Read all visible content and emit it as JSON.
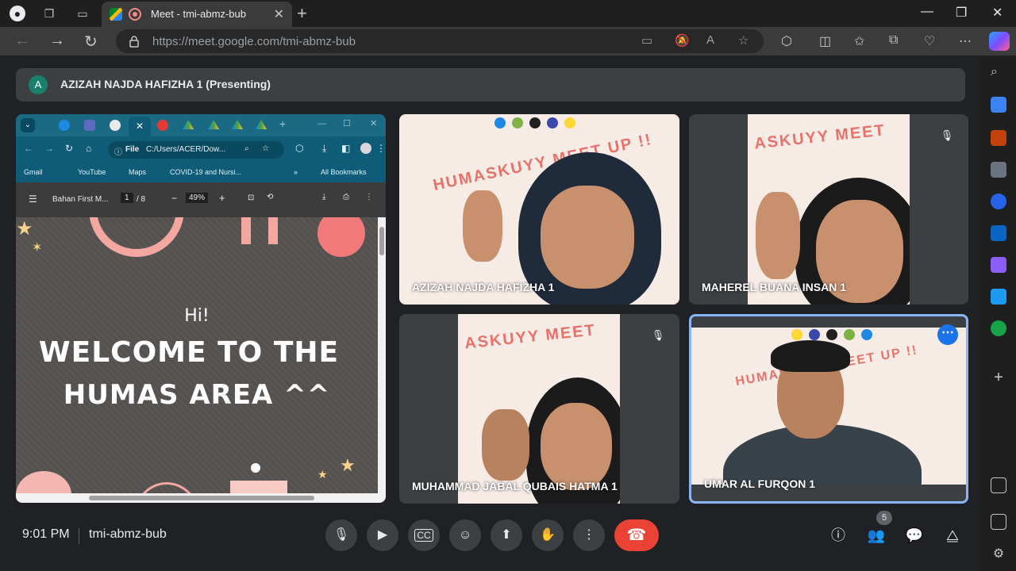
{
  "browser": {
    "tab_title": "Meet - tmi-abmz-bub",
    "url_domain": "https://meet.google.com/",
    "url_path": "tmi-abmz-bub"
  },
  "presenting_banner": {
    "avatar_letter": "A",
    "text": "AZIZAH NAJDA HAFIZHA 1 (Presenting)"
  },
  "shared_screen": {
    "file_label": "File",
    "path": "C:/Users/ACER/Dow...",
    "bookmarks": [
      "Gmail",
      "YouTube",
      "Maps",
      "COVID-19 and Nursi..."
    ],
    "all_bookmarks": "All Bookmarks",
    "pdf_title": "Bahan First M...",
    "page_current": "1",
    "page_total": "/ 8",
    "zoom": "49%",
    "slide_hi": "Hi!",
    "slide_line1": "WELCOME TO THE",
    "slide_line2": "HUMAS AREA ^^"
  },
  "participants": [
    {
      "name": "AZIZAH NAJDA HAFIZHA 1",
      "muted": false,
      "banner": "HUMASKUYY MEET UP !!"
    },
    {
      "name": "MAHEREL BUANA INSAN 1",
      "muted": true,
      "banner": "ASKUYY MEET"
    },
    {
      "name": "MUHAMMAD JABAL QUBAIS HATMA 1",
      "muted": true,
      "banner": "ASKUYY MEET"
    },
    {
      "name": "UMAR AL FURQON 1",
      "muted": false,
      "banner": "HUMASKUYY MEET UP !!"
    }
  ],
  "bottom_bar": {
    "time": "9:01 PM",
    "meeting_code": "tmi-abmz-bub",
    "people_count": "5"
  },
  "colors": {
    "end_call": "#ea4335",
    "active_speaker": "#8ab4f8",
    "accent": "#1a73e8"
  }
}
